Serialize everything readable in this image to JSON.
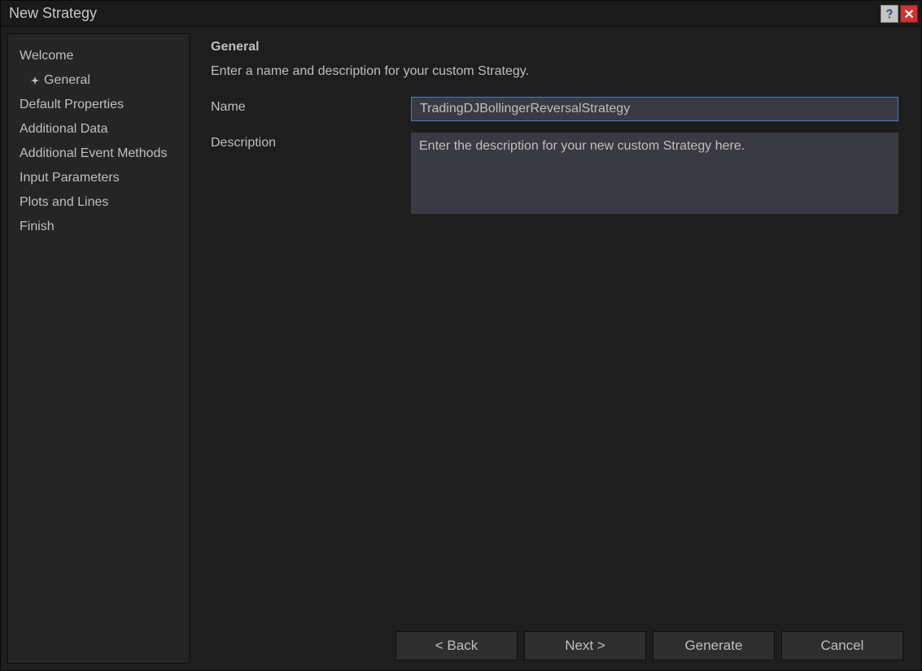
{
  "titlebar": {
    "title": "New Strategy"
  },
  "sidebar": {
    "items": [
      {
        "label": "Welcome",
        "sub": [
          {
            "label": "General"
          }
        ]
      },
      {
        "label": "Default Properties"
      },
      {
        "label": "Additional Data"
      },
      {
        "label": "Additional Event Methods"
      },
      {
        "label": "Input Parameters"
      },
      {
        "label": "Plots and Lines"
      },
      {
        "label": "Finish"
      }
    ]
  },
  "main": {
    "header": "General",
    "subtext": "Enter a name and description for your custom Strategy.",
    "name_label": "Name",
    "name_value": "TradingDJBollingerReversalStrategy",
    "description_label": "Description",
    "description_placeholder": "Enter the description for your new custom Strategy here."
  },
  "buttons": {
    "back": "< Back",
    "next": "Next >",
    "generate": "Generate",
    "cancel": "Cancel"
  }
}
